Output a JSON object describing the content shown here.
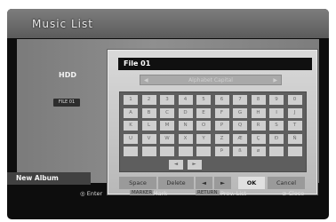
{
  "window": {
    "title": "Music List"
  },
  "sidebar": {
    "storage_label": "HDD",
    "file_tag": "FILE 01",
    "new_album_label": "New Album"
  },
  "dialog": {
    "name_value": "File 01",
    "mode_label": "Alphabet Capital",
    "mode_arrow_left": "◀",
    "mode_arrow_right": "▶",
    "keys": [
      [
        "1",
        "2",
        "3",
        "4",
        "5",
        "6",
        "7",
        "8",
        "9",
        "0"
      ],
      [
        "A",
        "B",
        "C",
        "D",
        "E",
        "F",
        "G",
        "H",
        "I",
        "J"
      ],
      [
        "K",
        "L",
        "M",
        "N",
        "O",
        "P",
        "Q",
        "R",
        "S",
        "T"
      ],
      [
        "U",
        "V",
        "W",
        "X",
        "Y",
        "Z",
        "Æ",
        "Ç",
        "Ð",
        "Ñ"
      ],
      [
        "",
        "",
        "",
        "",
        "",
        "Þ",
        "ß",
        "ø",
        "",
        ""
      ],
      [
        "◄",
        "►"
      ]
    ],
    "commands": {
      "space": "Space",
      "delete": "Delete",
      "left": "◄",
      "right": "►",
      "ok": "OK",
      "cancel": "Cancel"
    }
  },
  "footer": {
    "enter": "◎ Enter",
    "mark_key": "MARKER",
    "mark": "Mark",
    "prev_key": "RETURN",
    "prev": "Prev. List",
    "close": "⊘ Close"
  }
}
